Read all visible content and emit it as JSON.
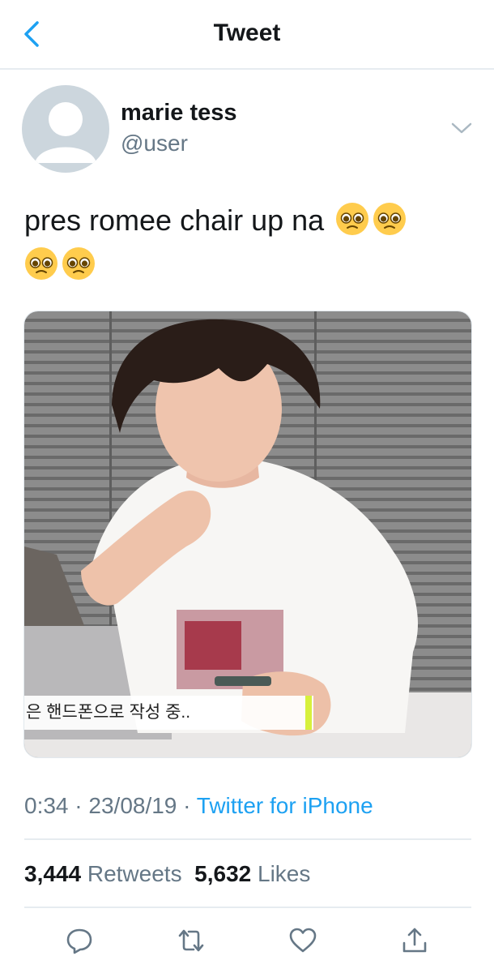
{
  "nav": {
    "title": "Tweet",
    "back_icon": "chevron-left-icon"
  },
  "author": {
    "name": "marie tess",
    "handle": "@user",
    "avatar_icon": "default-avatar-icon"
  },
  "tweet": {
    "text": "pres romee chair up na",
    "emoji": [
      "pleading-face-emoji",
      "pleading-face-emoji",
      "pleading-face-emoji",
      "pleading-face-emoji"
    ],
    "media_caption": "은 핸드폰으로 작성 중.."
  },
  "meta": {
    "time": "0:34",
    "date": "23/08/19",
    "separator": "·",
    "source": "Twitter for iPhone"
  },
  "stats": {
    "retweets_count": "3,444",
    "retweets_label": "Retweets",
    "likes_count": "5,632",
    "likes_label": "Likes"
  },
  "actions": [
    "reply-icon",
    "retweet-icon",
    "like-icon",
    "share-icon"
  ],
  "colors": {
    "accent": "#1da1f2",
    "secondary_text": "#657786",
    "divider": "#e6ecf0"
  }
}
